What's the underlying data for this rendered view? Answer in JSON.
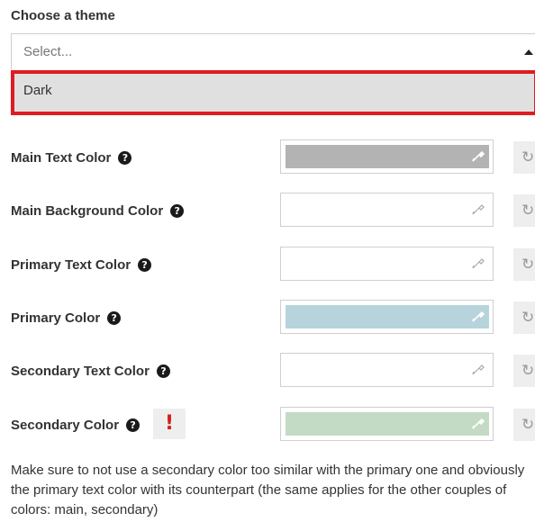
{
  "theme": {
    "title": "Choose a theme",
    "select_placeholder": "Select...",
    "highlighted_option": "Dark"
  },
  "settings": [
    {
      "label": "Main Text Color",
      "swatch_color": "#b3b3b3",
      "help_icon": "question-circle-icon"
    },
    {
      "label": "Main Background Color",
      "swatch_color": "#ffffff",
      "help_icon": "question-circle-icon"
    },
    {
      "label": "Primary Text Color",
      "swatch_color": "#ffffff",
      "help_icon": "question-circle-icon"
    },
    {
      "label": "Primary Color",
      "swatch_color": "#b7d4dc",
      "help_icon": "question-circle-icon"
    },
    {
      "label": "Secondary Text Color",
      "swatch_color": "#ffffff",
      "help_icon": "question-circle-icon"
    },
    {
      "label": "Secondary Color",
      "swatch_color": "#c3dbc4",
      "help_icon": "question-circle-icon",
      "warning": "!"
    }
  ],
  "note": "Make sure to not use a secondary color too similar with the primary one and obviously the primary text color with its counterpart (the same applies for the other couples of colors: main, secondary)",
  "colors": {
    "highlight_border": "#e11b22",
    "highlight_bg": "#e0e0e0",
    "warning": "#d21e1e"
  }
}
